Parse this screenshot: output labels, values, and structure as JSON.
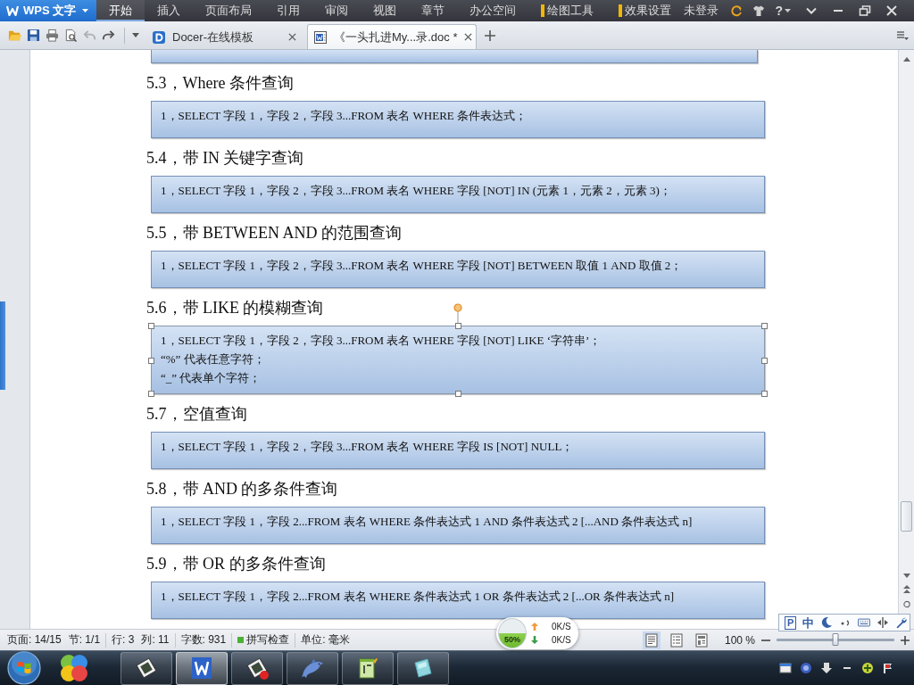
{
  "app_menu": "WPS 文字",
  "menu_tabs": [
    {
      "label": "开始",
      "kind": "tab",
      "selected": true
    },
    {
      "label": "插入",
      "kind": "tab",
      "selected": false
    },
    {
      "label": "页面布局",
      "kind": "tab",
      "selected": false
    },
    {
      "label": "引用",
      "kind": "tab",
      "selected": false
    },
    {
      "label": "审阅",
      "kind": "tab",
      "selected": false
    },
    {
      "label": "视图",
      "kind": "tab",
      "selected": false
    },
    {
      "label": "章节",
      "kind": "tab",
      "selected": false
    },
    {
      "label": "办公空间",
      "kind": "tab",
      "selected": false
    },
    {
      "label": "绘图工具",
      "kind": "context",
      "selected": false
    },
    {
      "label": "效果设置",
      "kind": "context",
      "selected": false
    }
  ],
  "account": "未登录",
  "help": "?",
  "quick_access": [
    {
      "kind": "open",
      "disabled": false
    },
    {
      "kind": "save",
      "disabled": false
    },
    {
      "kind": "print",
      "disabled": false
    },
    {
      "kind": "preview",
      "disabled": false
    },
    {
      "kind": "undo",
      "disabled": true
    },
    {
      "kind": "redo",
      "disabled": false
    }
  ],
  "doc_tabs": [
    {
      "kind": "docer",
      "title": "Docer-在线模板",
      "selected": false
    },
    {
      "kind": "document",
      "title": "《一头扎进My...录.doc *",
      "selected": true
    }
  ],
  "document": {
    "sections": [
      {
        "heading": "5.3，Where 条件查询",
        "box": {
          "selected": false,
          "lines": [
            "1，SELECT 字段 1，字段 2，字段 3...FROM 表名 WHERE 条件表达式；"
          ]
        }
      },
      {
        "heading": "5.4，带 IN 关键字查询",
        "box": {
          "selected": false,
          "lines": [
            "1，SELECT 字段 1，字段 2，字段 3...FROM 表名 WHERE 字段 [NOT] IN (元素 1，元素 2，元素 3)；"
          ]
        }
      },
      {
        "heading": "5.5，带 BETWEEN AND 的范围查询",
        "box": {
          "selected": false,
          "lines": [
            "1，SELECT 字段 1，字段 2，字段 3...FROM 表名 WHERE 字段 [NOT] BETWEEN 取值 1 AND 取值 2；"
          ]
        }
      },
      {
        "heading": "5.6，带 LIKE 的模糊查询",
        "box": {
          "selected": true,
          "lines": [
            "1，SELECT 字段 1，字段 2，字段 3...FROM 表名 WHERE 字段 [NOT] LIKE ‘字符串’；",
            "“%” 代表任意字符；",
            "“_” 代表单个字符；"
          ]
        }
      },
      {
        "heading": "5.7，空值查询",
        "box": {
          "selected": false,
          "lines": [
            "1，SELECT 字段 1，字段 2，字段 3...FROM 表名 WHERE 字段 IS [NOT] NULL；"
          ]
        }
      },
      {
        "heading": "5.8，带 AND 的多条件查询",
        "box": {
          "selected": false,
          "lines": [
            "1，SELECT 字段 1，字段 2...FROM 表名 WHERE 条件表达式 1 AND 条件表达式 2 [...AND 条件表达式 n]"
          ]
        }
      },
      {
        "heading": "5.9，带 OR 的多条件查询",
        "box": {
          "selected": false,
          "lines": [
            "1，SELECT 字段 1，字段 2...FROM 表名 WHERE 条件表达式 1 OR 条件表达式 2 [...OR 条件表达式 n]"
          ]
        }
      }
    ]
  },
  "status_bar": {
    "groups": [
      {
        "items": [
          "页面: 14/15",
          "节: 1/1"
        ]
      },
      {
        "items": [
          "行: 3",
          "列: 11"
        ]
      },
      {
        "items": [
          "字数: 931"
        ]
      }
    ],
    "spell_check": {
      "label": "拼写检查",
      "on": true
    },
    "unit": "单位: 毫米",
    "views": [
      {
        "kind": "page",
        "selected": true
      },
      {
        "kind": "outline",
        "selected": false
      },
      {
        "kind": "web",
        "selected": false
      }
    ],
    "zoom": {
      "reading": "100 %",
      "level": 0.5
    }
  },
  "speed_widget": {
    "memory": {
      "reading": "50%",
      "level": 0.5
    },
    "upload": "0K/S",
    "download": "0K/S"
  },
  "ime_bar": {
    "logo": "P",
    "mode": "中"
  },
  "taskbar": {
    "items": [
      {
        "kind": "frame",
        "selected": false
      },
      {
        "kind": "wps",
        "selected": true
      },
      {
        "kind": "frame-record",
        "selected": false
      },
      {
        "kind": "dolphin",
        "selected": false
      },
      {
        "kind": "notepad",
        "selected": false
      },
      {
        "kind": "sheet",
        "selected": false
      }
    ]
  }
}
